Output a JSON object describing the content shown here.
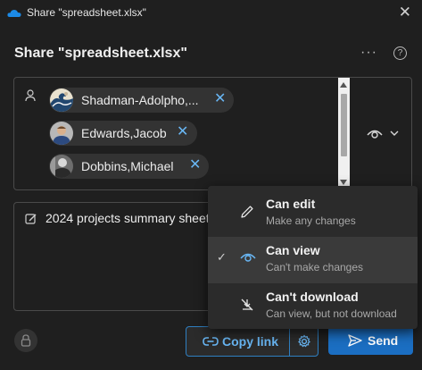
{
  "window": {
    "title": "Share \"spreadsheet.xlsx\"",
    "close_glyph": "✕"
  },
  "dialog": {
    "heading": "Share \"spreadsheet.xlsx\"",
    "more_glyph": "···",
    "help_glyph": "?"
  },
  "recipients": [
    {
      "name": "Shadman-Adolpho,...",
      "avatar": "wave-art"
    },
    {
      "name": "Edwards,Jacob",
      "avatar": "person-photo"
    },
    {
      "name": "Dobbins,Michael",
      "avatar": "bw-photo"
    }
  ],
  "remove_glyph": "✕",
  "message": {
    "text": "2024 projects summary sheet"
  },
  "buttons": {
    "copy_link": "Copy link",
    "send": "Send"
  },
  "permission_menu": {
    "selected": "Can view",
    "items": [
      {
        "title": "Can edit",
        "subtitle": "Make any changes",
        "icon": "pencil-icon",
        "check": ""
      },
      {
        "title": "Can view",
        "subtitle": "Can't make changes",
        "icon": "eye-icon",
        "check": "✓"
      },
      {
        "title": "Can't download",
        "subtitle": "Can view, but not download",
        "icon": "no-download-icon",
        "check": ""
      }
    ]
  },
  "colors": {
    "accent": "#69b7f5",
    "primary_button": "#1b6ec2",
    "background": "#1f1f1f",
    "chip": "#333333"
  }
}
